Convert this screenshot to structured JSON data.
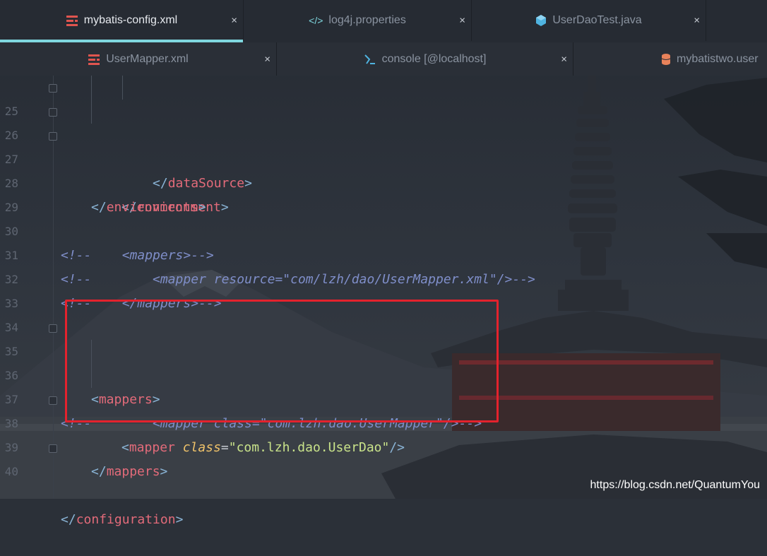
{
  "tabs_row1": [
    {
      "label": "mybatis-config.xml",
      "icon": "xml-config-icon",
      "active": true,
      "close": "×"
    },
    {
      "label": "log4j.properties",
      "icon": "code-brackets-icon",
      "active": false,
      "close": "×"
    },
    {
      "label": "UserDaoTest.java",
      "icon": "java-class-icon",
      "active": false,
      "close": "×"
    }
  ],
  "tabs_row2": [
    {
      "label": "UserMapper.xml",
      "icon": "xml-config-icon",
      "close": "×"
    },
    {
      "label": "console [@localhost]",
      "icon": "sql-console-icon",
      "close": "×"
    },
    {
      "label": "mybatistwo.user",
      "icon": "database-table-icon"
    }
  ],
  "line_numbers": [
    "25",
    "26",
    "27",
    "28",
    "29",
    "30",
    "31",
    "32",
    "33",
    "34",
    "35",
    "36",
    "37",
    "38",
    "39",
    "40"
  ],
  "code": {
    "l25_tag": "dataSource",
    "l26_tag": "environment",
    "l27_tag": "environments",
    "l30": "<!--    <mappers>-->",
    "l31": "<!--        <mapper resource=\"com/lzh/dao/UserMapper.xml\"/>-->",
    "l32": "<!--    </mappers>-->",
    "l35_tag": "mappers",
    "l36": "<!--        <mapper class=\"com.lzh.dao.UserMapper\"/>-->",
    "l37_tag": "mapper",
    "l37_attr": "class",
    "l37_val": "\"com.lzh.dao.UserDao\"",
    "l38_tag": "mappers",
    "l40_tag": "configuration"
  },
  "colors": {
    "tag": "#e36b7a",
    "comment": "#7f8ec9",
    "attribute": "#f0c36a",
    "string": "#c9e38a",
    "highlight_box": "#e4222d",
    "active_tab_underline": "#7fd7df"
  },
  "watermark": "https://blog.csdn.net/QuantumYou"
}
